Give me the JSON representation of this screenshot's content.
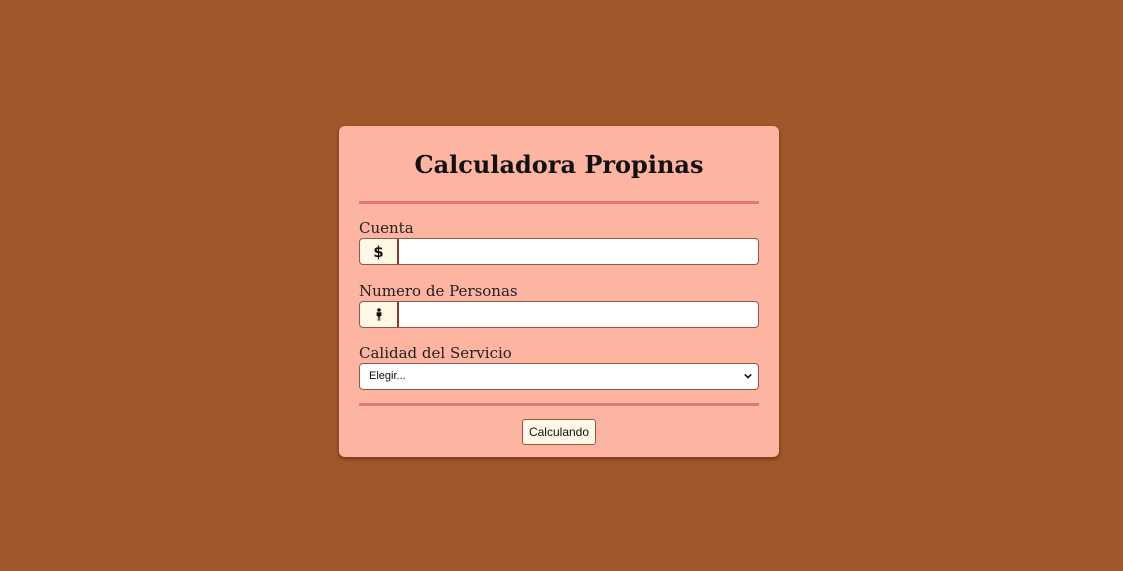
{
  "app": {
    "title": "Calculadora Propinas"
  },
  "form": {
    "bill": {
      "label": "Cuenta",
      "prefix_symbol": "$",
      "value": ""
    },
    "people": {
      "label": "Numero de Personas",
      "prefix_icon": "person-icon",
      "value": ""
    },
    "service": {
      "label": "Calidad del Servicio",
      "selected": "Elegir..."
    },
    "submit_label": "Calculando"
  },
  "colors": {
    "background": "#a0572a",
    "card": "#fdb5a2",
    "divider": "#e07a6e",
    "addon": "#fff8e7"
  }
}
